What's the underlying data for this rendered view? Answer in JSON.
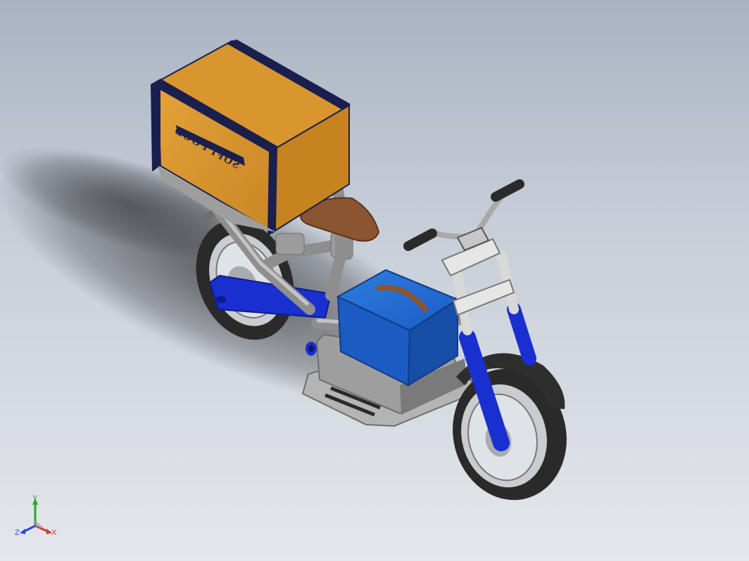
{
  "viewport": {
    "model": "delivery-scooter",
    "box_text": "SOFI FOOD"
  },
  "triad": {
    "x_label": "X",
    "y_label": "Y",
    "z_label": "Z"
  },
  "colors": {
    "background_top": "#a9b3c2",
    "background_bottom": "#e4e7eb",
    "box": "#d9962f",
    "box_trim": "#1a1f4e",
    "frame_blue": "#1a2fd0",
    "battery_blue": "#1e63c9",
    "frame_gray": "#9a9a9a",
    "seat": "#8a5530",
    "tire": "#2a2a2a",
    "axis_x": "#e23030",
    "axis_y": "#2ea52e",
    "axis_z": "#2a48d8"
  }
}
